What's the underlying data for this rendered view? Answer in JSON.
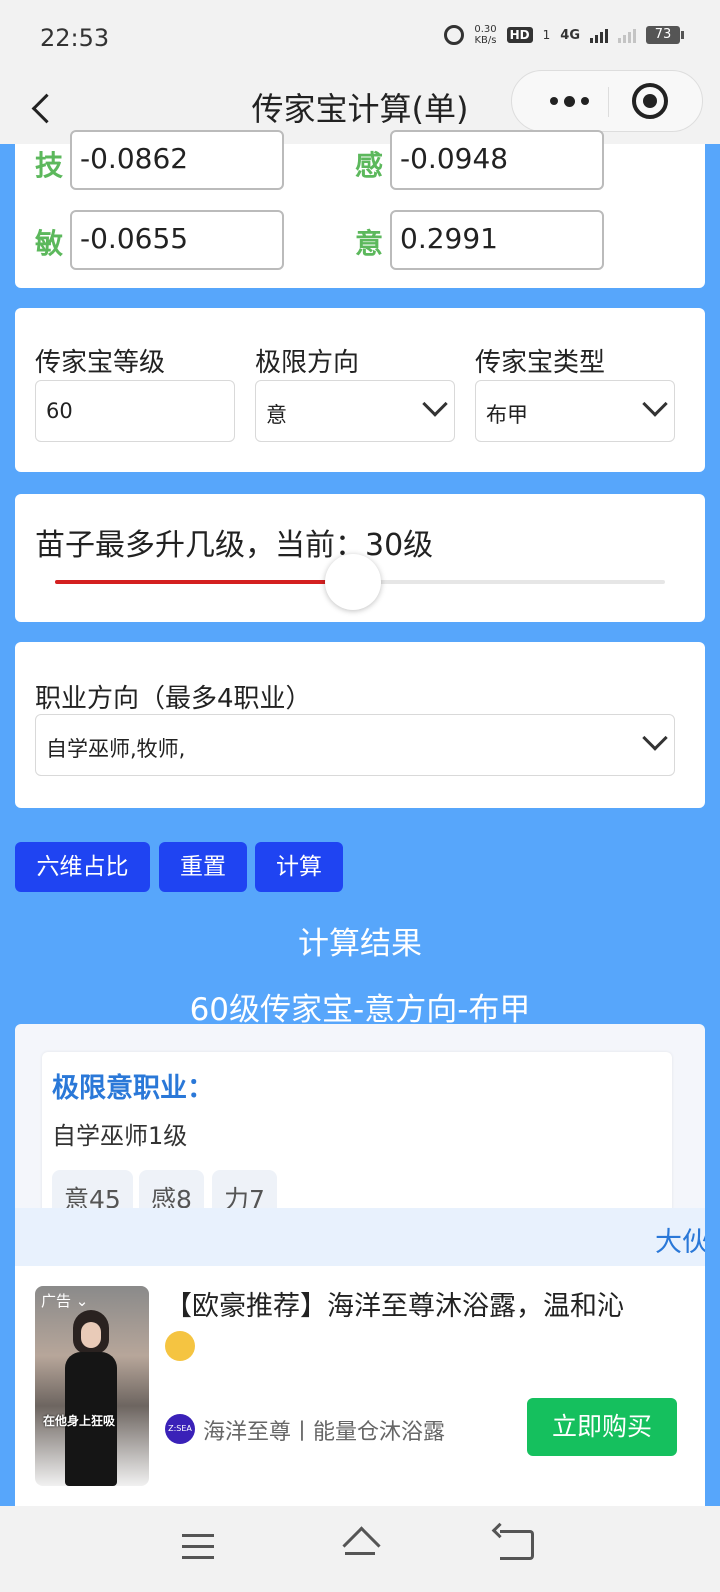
{
  "status": {
    "time": "22:53",
    "net_speed_top": "0.30",
    "net_speed_unit": "KB/s",
    "hd": "HD",
    "hd_sub": "1",
    "network": "4G",
    "battery": "73"
  },
  "nav": {
    "title": "传家宝计算(单)"
  },
  "attributes": [
    {
      "letter": "技",
      "value": "-0.0862"
    },
    {
      "letter": "感",
      "value": "-0.0948"
    },
    {
      "letter": "敏",
      "value": "-0.0655"
    },
    {
      "letter": "意",
      "value": "0.2991"
    }
  ],
  "settings": {
    "level_label": "传家宝等级",
    "level_value": "60",
    "direction_label": "极限方向",
    "direction_value": "意",
    "type_label": "传家宝类型",
    "type_value": "布甲"
  },
  "slider": {
    "label": "苗子最多升几级，当前：30级",
    "fraction": 0.488
  },
  "profession": {
    "label": "职业方向（最多4职业）",
    "value": "自学巫师,牧师,"
  },
  "buttons": {
    "ratio": "六维占比",
    "reset": "重置",
    "calc": "计算"
  },
  "results": {
    "title": "计算结果",
    "subtitle": "60级传家宝-意方向-布甲",
    "prof_head": "极限意职业：",
    "prof_name": "自学巫师1级",
    "tags": [
      "意45",
      "感8",
      "力7"
    ]
  },
  "marquee": "大伙",
  "ad": {
    "badge": "广告 ⌄",
    "caption": "在他身上狂吸",
    "text_line1": "【欧豪推荐】海洋至尊沐浴露，温和沁",
    "brand_logo": "Z:SEA",
    "brand": "海洋至尊丨能量仓沐浴露",
    "buy": "立即购买"
  },
  "colors": {
    "page_bg": "#57a6fb",
    "button": "#1f44f2",
    "accent_green": "#5cb85c",
    "slider_red": "#d42020",
    "buy_green": "#15c05e",
    "link_blue": "#2a78d8"
  }
}
